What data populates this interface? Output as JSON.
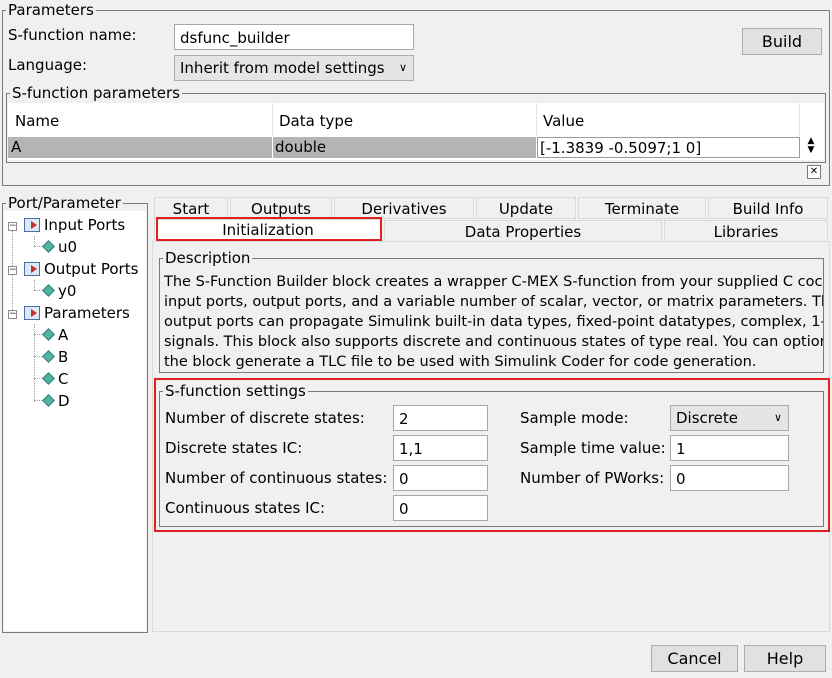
{
  "parameters": {
    "legend": "Parameters",
    "sfunction_name_label": "S-function name:",
    "sfunction_name_value": "dsfunc_builder",
    "language_label": "Language:",
    "language_value": "Inherit from model settings",
    "build_label": "Build"
  },
  "sfunction_parameters": {
    "legend": "S-function parameters",
    "columns": [
      "Name",
      "Data type",
      "Value"
    ],
    "rows": [
      {
        "name": "A",
        "data_type": "double",
        "value": "[-1.3839 -0.5097;1 0]"
      }
    ],
    "close_glyph": "✕"
  },
  "port_parameter": {
    "legend": "Port/Parameter",
    "tree": {
      "input_ports": "Input Ports",
      "u0": "u0",
      "output_ports": "Output Ports",
      "y0": "y0",
      "parameters": "Parameters",
      "A": "A",
      "B": "B",
      "C": "C",
      "D": "D"
    }
  },
  "tabs": {
    "row1": [
      "Start",
      "Outputs",
      "Derivatives",
      "Update",
      "Terminate",
      "Build Info"
    ],
    "row2": [
      "Initialization",
      "Data Properties",
      "Libraries"
    ],
    "active": "Initialization"
  },
  "description": {
    "legend": "Description",
    "lines": [
      "The S-Function Builder block creates a wrapper C-MEX S-function from your supplied C coc",
      "input ports, output ports, and a variable number of scalar, vector, or matrix parameters. The",
      "output ports can propagate Simulink built-in data types, fixed-point datatypes, complex, 1-",
      "signals. This block also supports discrete and continuous states of type real. You can optior",
      "the block generate a TLC file to be used with Simulink Coder for code generation."
    ]
  },
  "settings": {
    "legend": "S-function settings",
    "num_discrete_label": "Number of discrete states:",
    "num_discrete_value": "2",
    "discrete_ic_label": "Discrete states IC:",
    "discrete_ic_value": "1,1",
    "num_continuous_label": "Number of continuous states:",
    "num_continuous_value": "0",
    "continuous_ic_label": "Continuous states IC:",
    "continuous_ic_value": "0",
    "sample_mode_label": "Sample mode:",
    "sample_mode_value": "Discrete",
    "sample_time_label": "Sample time value:",
    "sample_time_value": "1",
    "num_pworks_label": "Number of PWorks:",
    "num_pworks_value": "0"
  },
  "footer": {
    "cancel_label": "Cancel",
    "help_label": "Help"
  }
}
